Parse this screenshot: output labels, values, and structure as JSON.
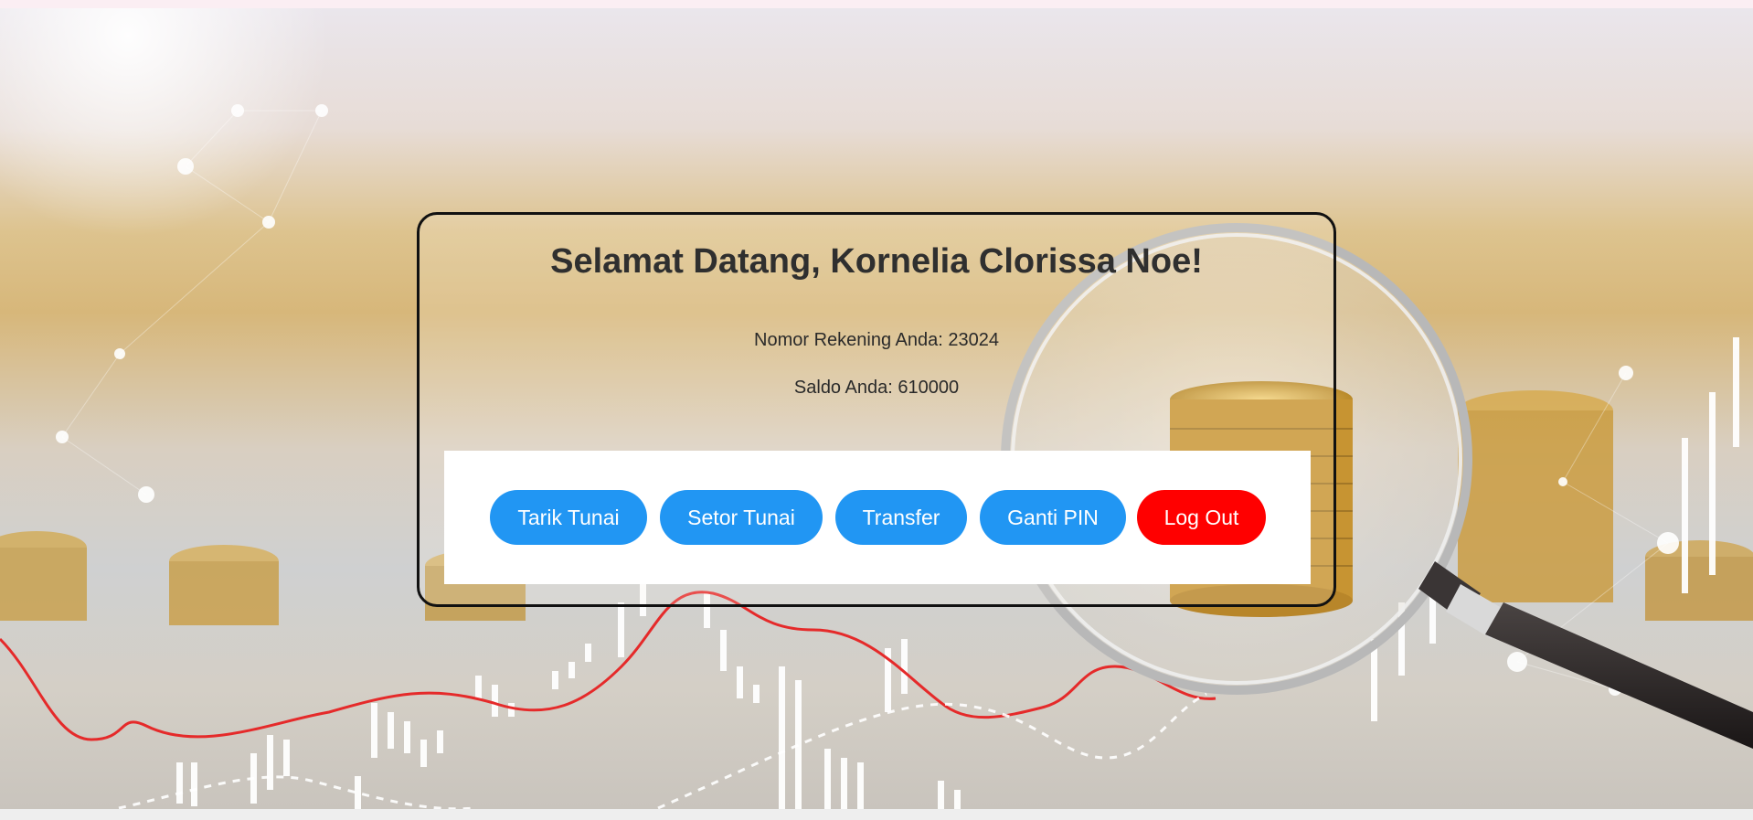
{
  "welcome": {
    "title": "Selamat Datang, Kornelia Clorissa Noe!",
    "account_line": "Nomor Rekening Anda: 23024",
    "balance_line": "Saldo Anda: 610000"
  },
  "actions": {
    "withdraw_label": "Tarik Tunai",
    "deposit_label": "Setor Tunai",
    "transfer_label": "Transfer",
    "change_pin_label": "Ganti PIN",
    "logout_label": "Log Out"
  },
  "colors": {
    "primary_button": "#2196f3",
    "logout_button": "#ff0000",
    "card_border": "#111111",
    "text": "#2f2f2f"
  }
}
